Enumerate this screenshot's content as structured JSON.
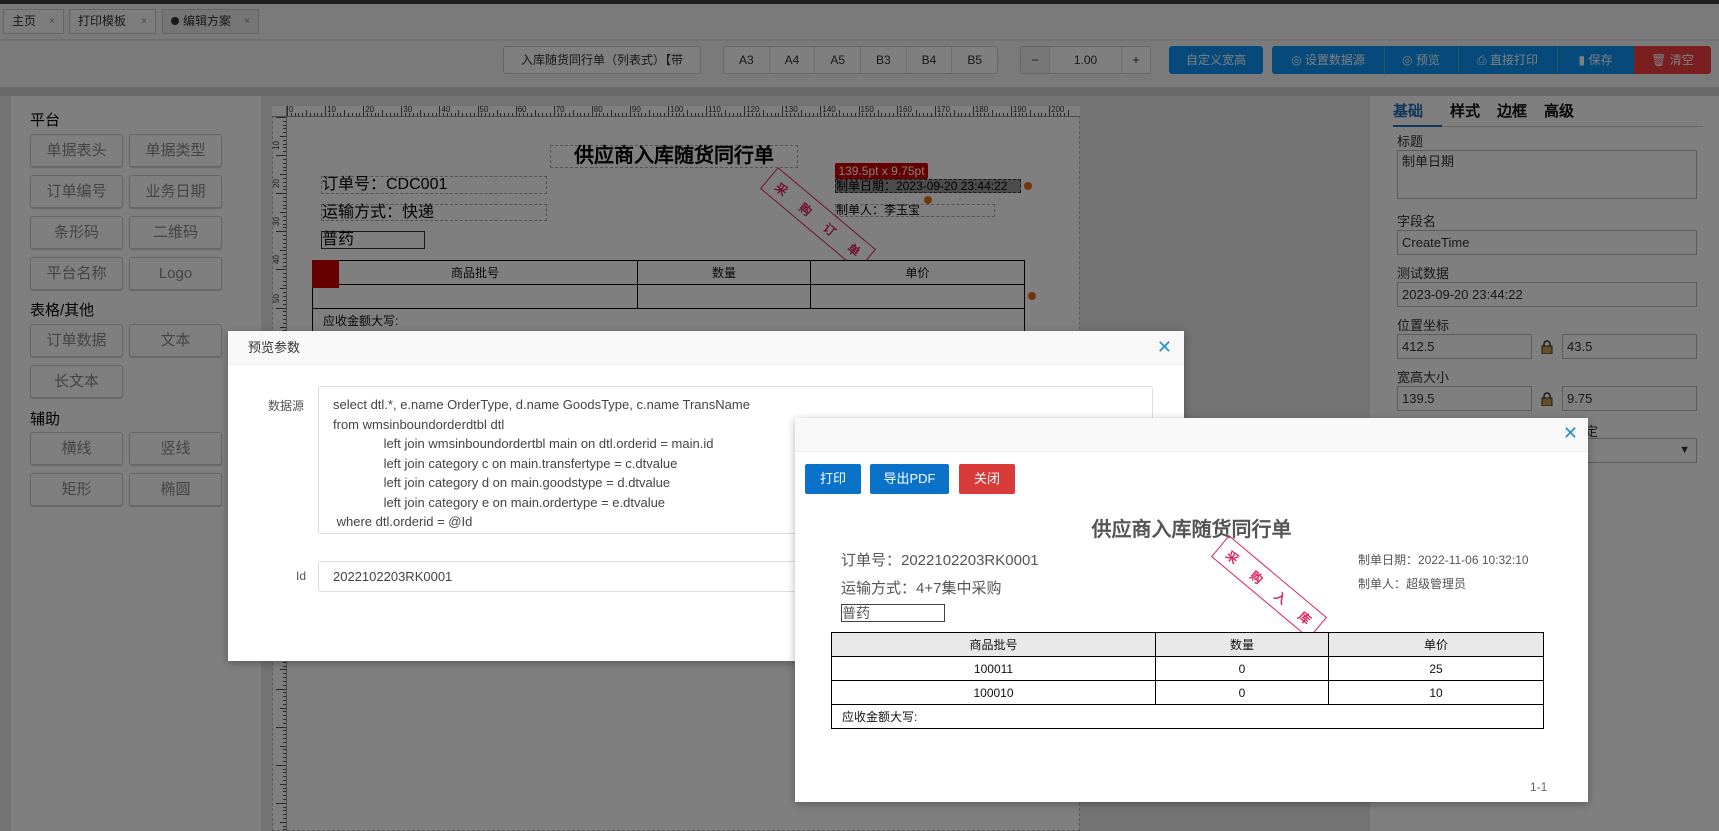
{
  "tabs": [
    {
      "label": "主页"
    },
    {
      "label": "打印模板"
    },
    {
      "label": "编辑方案"
    }
  ],
  "tab_close": "×",
  "toolbar": {
    "template_select": "入库随货同行单（列表式）【带",
    "paper_sizes": [
      "A3",
      "A4",
      "A5",
      "B3",
      "B4",
      "B5"
    ],
    "zoom_minus": "−",
    "zoom_value": "1.00",
    "zoom_plus": "+",
    "custom_size": "自定义宽高",
    "set_datasource": "设置数据源",
    "preview": "预览",
    "direct_print": "直接打印",
    "save": "保存",
    "clear": "清空"
  },
  "left_panel": {
    "sections": [
      {
        "title": "平台",
        "items": [
          "单据表头",
          "单据类型",
          "订单编号",
          "业务日期",
          "条形码",
          "二维码",
          "平台名称",
          "Logo"
        ]
      },
      {
        "title": "表格/其他",
        "items": [
          "订单数据",
          "文本",
          "长文本"
        ]
      },
      {
        "title": "辅助",
        "items": [
          "横线",
          "竖线",
          "矩形",
          "椭圆"
        ]
      }
    ]
  },
  "ruler": {
    "top": [
      "0",
      "10",
      "20",
      "30",
      "40",
      "50",
      "60",
      "70",
      "80",
      "90",
      "100",
      "110",
      "120",
      "130",
      "140",
      "150",
      "160",
      "170",
      "180",
      "190",
      "200"
    ],
    "left": [
      "10",
      "20",
      "30",
      "40",
      "50"
    ]
  },
  "design": {
    "title": "供应商入库随货同行单",
    "order_no": "订单号：CDC001",
    "transport": "运输方式：快递",
    "goods_type": "普药",
    "size_tip": "139.5pt x 9.75pt",
    "create_date": "制单日期：2023-09-20 23:44:22",
    "creator": "制单人：李玉宝",
    "stamp": [
      "采",
      "购",
      "订",
      "单"
    ],
    "table_headers": [
      "商品批号",
      "数量",
      "单价"
    ],
    "amount_label": "应收金额大写:"
  },
  "right_panel": {
    "tabs": [
      "基础",
      "样式",
      "边框",
      "高级"
    ],
    "title_label": "标题",
    "title_value": "制单日期",
    "field_label": "字段名",
    "field_value": "CreateTime",
    "test_label": "测试数据",
    "test_value": "2023-09-20 23:44:22",
    "pos_label": "位置坐标",
    "pos_x": "412.5",
    "pos_y": "43.5",
    "size_label": "宽高大小",
    "width": "139.5",
    "height": "9.75",
    "partial_label": "定"
  },
  "param_dialog": {
    "title": "预览参数",
    "datasource_label": "数据源",
    "sql_lines": [
      "select dtl.*, e.name OrderType, d.name GoodsType, c.name TransName",
      "from wmsinboundorderdtbl dtl",
      "        left join wmsinboundordertbl main on dtl.orderid = main.id",
      "        left join category c on main.transfertype = c.dtvalue",
      "        left join category d on main.goodstype = d.dtvalue",
      "        left join category e on main.ordertype = e.dtvalue",
      " where dtl.orderid = @Id"
    ],
    "id_label": "Id",
    "id_value": "2022102203RK0001"
  },
  "preview_dialog": {
    "print": "打印",
    "export_pdf": "导出PDF",
    "close": "关闭",
    "title": "供应商入库随货同行单",
    "order_no": "订单号：2022102203RK0001",
    "transport": "运输方式：4+7集中采购",
    "goods_type": "普药",
    "create_date": "制单日期：2022-11-06 10:32:10",
    "creator": "制单人：超级管理员",
    "stamp": [
      "采",
      "购",
      "入",
      "库"
    ],
    "table_headers": [
      "商品批号",
      "数量",
      "单价"
    ],
    "rows": [
      [
        "100011",
        "0",
        "25"
      ],
      [
        "100010",
        "0",
        "10"
      ]
    ],
    "amount_label": "应收金额大写:",
    "page": "1-1"
  },
  "colors": {
    "primary": "#0a72c8",
    "danger": "#d93a3a",
    "stamp": "#e0245e",
    "selection": "#cc0000"
  }
}
